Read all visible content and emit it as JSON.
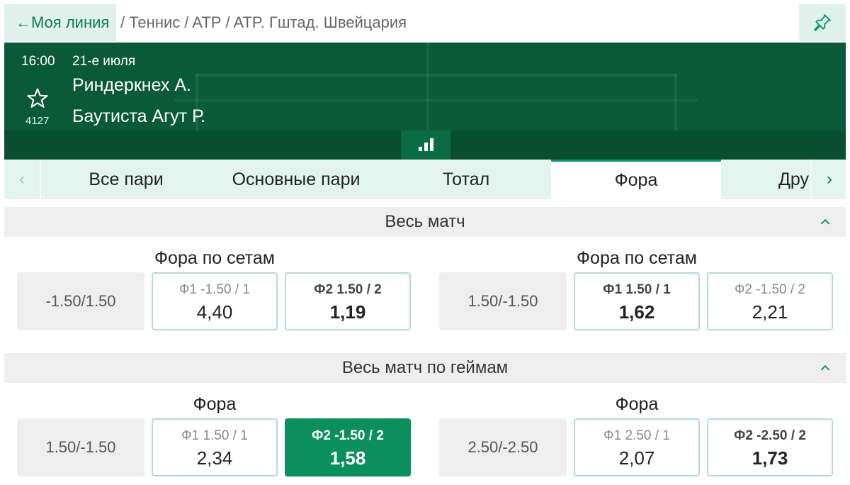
{
  "topbar": {
    "back_label": "←Моя линия",
    "breadcrumb": [
      "/ Теннис",
      "/ ATP",
      "/ ATP. Гштад. Швейцария"
    ],
    "pin_icon": "pin-icon"
  },
  "match": {
    "time": "16:00",
    "date": "21-е июля",
    "team1": "Риндеркнех А.",
    "team2": "Баутиста Агут Р.",
    "favorites_count": "4127"
  },
  "tabs": {
    "items": [
      "Все пари",
      "Основные пари",
      "Тотал",
      "Фора",
      "Дру"
    ],
    "active": "Фора"
  },
  "sections": [
    {
      "title": "Весь матч",
      "groups": [
        {
          "title": "Фора по сетам",
          "param": "-1.50/1.50",
          "odds": [
            {
              "label": "Ф1 -1.50 / 1",
              "value": "4,40"
            },
            {
              "label": "Ф2 1.50 / 2",
              "value": "1,19"
            }
          ]
        },
        {
          "title": "Фора по сетам",
          "param": "1.50/-1.50",
          "odds": [
            {
              "label": "Ф1 1.50 / 1",
              "value": "1,62"
            },
            {
              "label": "Ф2 -1.50 / 2",
              "value": "2,21"
            }
          ]
        }
      ]
    },
    {
      "title": "Весь матч по геймам",
      "groups": [
        {
          "title": "Фора",
          "param": "1.50/-1.50",
          "odds": [
            {
              "label": "Ф1 1.50 / 1",
              "value": "2,34"
            },
            {
              "label": "Ф2 -1.50 / 2",
              "value": "1,58"
            }
          ]
        },
        {
          "title": "Фора",
          "param": "2.50/-2.50",
          "odds": [
            {
              "label": "Ф1 2.50 / 1",
              "value": "2,07"
            },
            {
              "label": "Ф2 -2.50 / 2",
              "value": "1,73"
            }
          ]
        }
      ]
    }
  ],
  "colors": {
    "brand_green": "#0c8f5e",
    "header_bg": "#0a5a3a",
    "light_green": "#dff1ea"
  }
}
